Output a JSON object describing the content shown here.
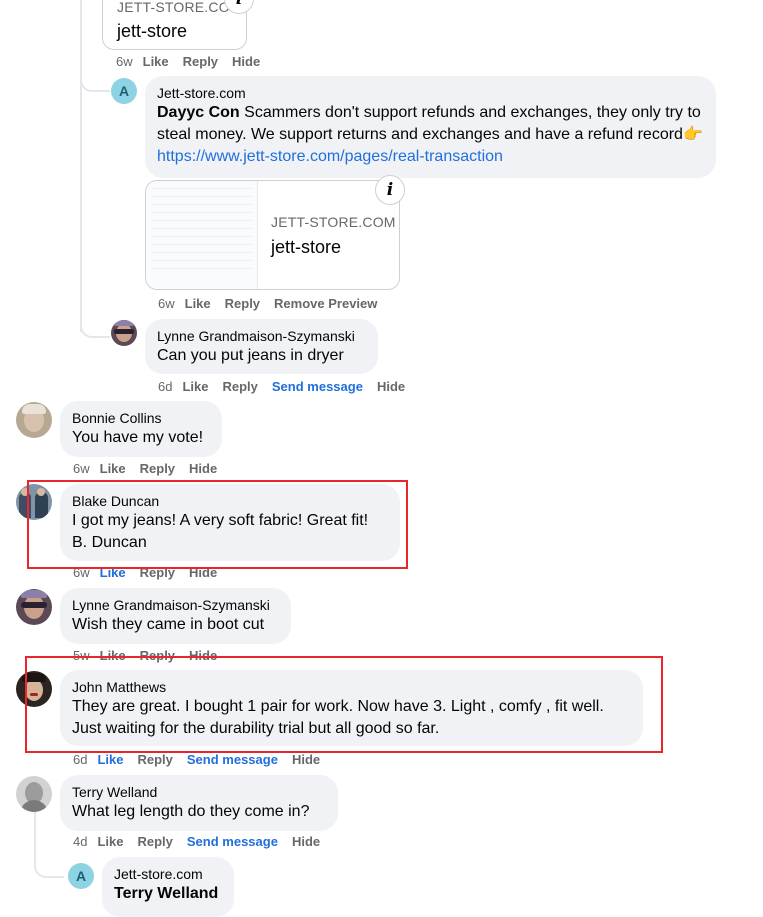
{
  "preview_top": {
    "domain": "JETT-STORE.COI",
    "title": "jett-store"
  },
  "actions_1": {
    "time": "6w",
    "like": "Like",
    "reply": "Reply",
    "hide": "Hide"
  },
  "comment_jett_1": {
    "avatar_letter": "A",
    "name": "Jett-store.com",
    "mention": "Dayyc Con",
    "text": " Scammers don't support refunds and exchanges, they only try to steal money. We support returns and exchanges and have a refund record👉",
    "link": "https://www.jett-store.com/pages/real-transaction",
    "preview": {
      "domain": "JETT-STORE.COM",
      "title": "jett-store"
    },
    "actions": {
      "time": "6w",
      "like": "Like",
      "reply": "Reply",
      "remove": "Remove Preview"
    }
  },
  "comment_lynne_1": {
    "name": "Lynne Grandmaison-Szymanski",
    "text": "Can you put jeans in dryer",
    "actions": {
      "time": "6d",
      "like": "Like",
      "reply": "Reply",
      "send": "Send message",
      "hide": "Hide"
    }
  },
  "comment_bonnie": {
    "name": "Bonnie Collins",
    "text": "You have my vote!",
    "actions": {
      "time": "6w",
      "like": "Like",
      "reply": "Reply",
      "hide": "Hide"
    }
  },
  "comment_blake": {
    "name": "Blake Duncan",
    "line1": "I got my jeans! A very soft fabric! Great fit!",
    "line2": "B. Duncan",
    "actions": {
      "time": "6w",
      "like": "Like",
      "reply": "Reply",
      "hide": "Hide"
    }
  },
  "comment_lynne_2": {
    "name": "Lynne Grandmaison-Szymanski",
    "text": "Wish they came in boot cut",
    "actions": {
      "time": "5w",
      "like": "Like",
      "reply": "Reply",
      "hide": "Hide"
    }
  },
  "comment_john": {
    "name": "John Matthews",
    "line1": "They are great. I bought 1 pair for work. Now have 3. Light , comfy , fit well.",
    "line2": "Just waiting for the durability trial but all good so far.",
    "actions": {
      "time": "6d",
      "like": "Like",
      "reply": "Reply",
      "send": "Send message",
      "hide": "Hide"
    }
  },
  "comment_terry": {
    "name": "Terry Welland",
    "text": "What leg length do they come in?",
    "actions": {
      "time": "4d",
      "like": "Like",
      "reply": "Reply",
      "send": "Send message",
      "hide": "Hide"
    }
  },
  "comment_jett_2": {
    "avatar_letter": "A",
    "name": "Jett-store.com",
    "mention": "Terry Welland"
  },
  "colors": {
    "link": "#216fdb",
    "bubble": "#f0f2f5",
    "highlight": "#e8262b",
    "meta": "#65676b"
  }
}
